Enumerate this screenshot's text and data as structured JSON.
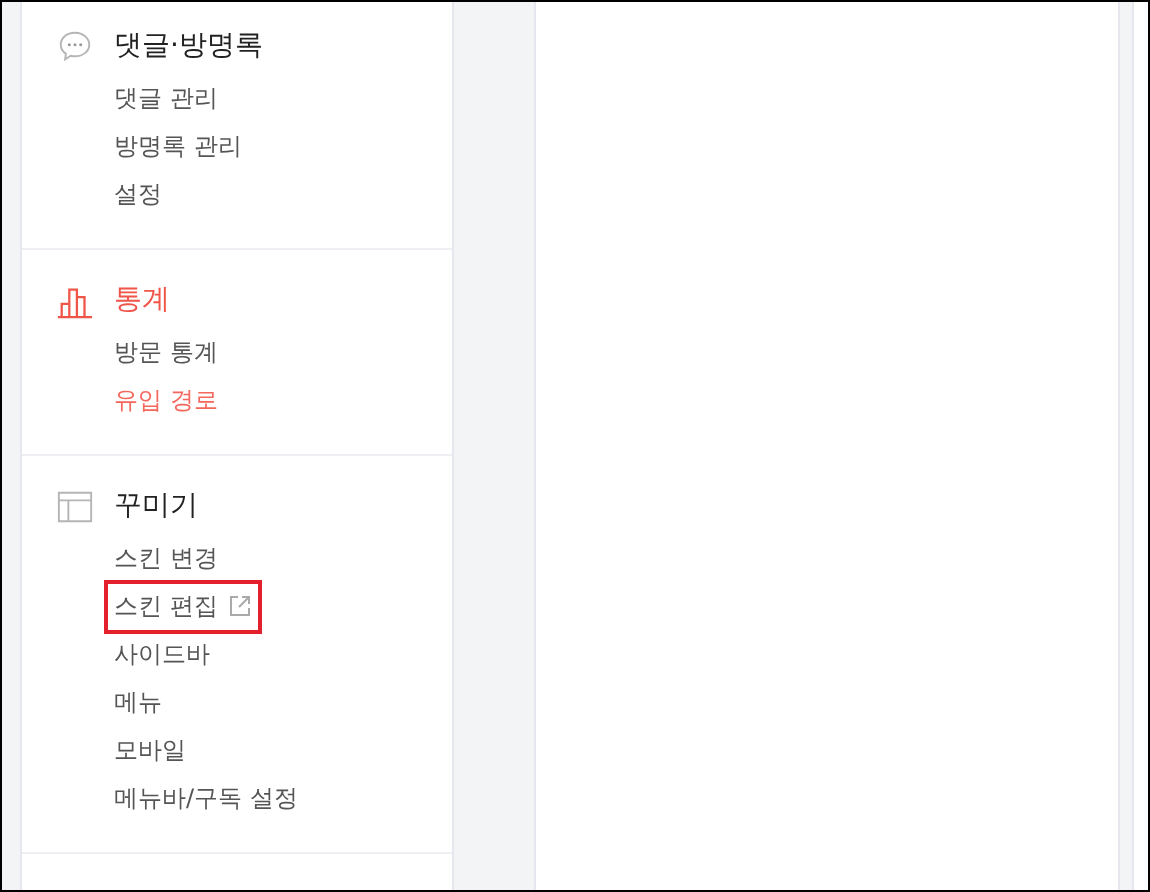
{
  "sidebar": {
    "sections": [
      {
        "kind": "comments",
        "title": "댓글·방명록",
        "active": false,
        "items": [
          {
            "label": "댓글 관리",
            "selected": false,
            "external": false,
            "highlighted": false
          },
          {
            "label": "방명록 관리",
            "selected": false,
            "external": false,
            "highlighted": false
          },
          {
            "label": "설정",
            "selected": false,
            "external": false,
            "highlighted": false
          }
        ]
      },
      {
        "kind": "stats",
        "title": "통계",
        "active": true,
        "items": [
          {
            "label": "방문 통계",
            "selected": false,
            "external": false,
            "highlighted": false
          },
          {
            "label": "유입 경로",
            "selected": true,
            "external": false,
            "highlighted": false
          }
        ]
      },
      {
        "kind": "design",
        "title": "꾸미기",
        "active": false,
        "items": [
          {
            "label": "스킨 변경",
            "selected": false,
            "external": false,
            "highlighted": false
          },
          {
            "label": "스킨 편집",
            "selected": false,
            "external": true,
            "highlighted": true
          },
          {
            "label": "사이드바",
            "selected": false,
            "external": false,
            "highlighted": false
          },
          {
            "label": "메뉴",
            "selected": false,
            "external": false,
            "highlighted": false
          },
          {
            "label": "모바일",
            "selected": false,
            "external": false,
            "highlighted": false
          },
          {
            "label": "메뉴바/구독 설정",
            "selected": false,
            "external": false,
            "highlighted": false
          }
        ]
      }
    ]
  }
}
